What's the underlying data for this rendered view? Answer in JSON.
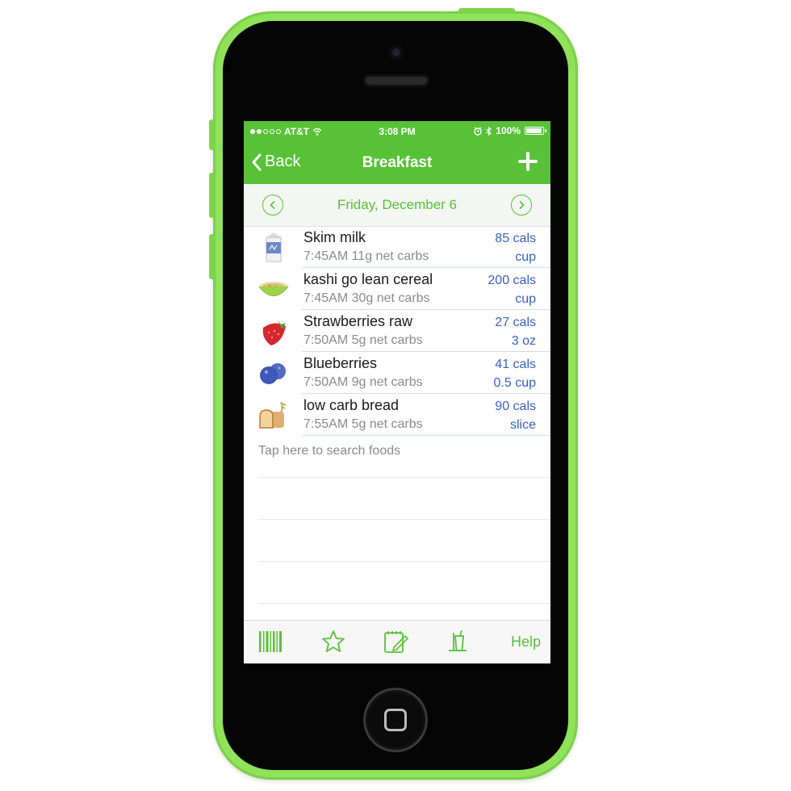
{
  "status_bar": {
    "carrier": "AT&T",
    "time": "3:08 PM",
    "battery": "100%",
    "signal_bars": 2,
    "icons": [
      "wifi-icon",
      "alarm-icon",
      "bluetooth-icon",
      "battery-icon"
    ]
  },
  "nav": {
    "back_label": "Back",
    "title": "Breakfast",
    "add_icon": "plus-icon"
  },
  "date_bar": {
    "date": "Friday, December 6",
    "prev_icon": "chevron-left-icon",
    "next_icon": "chevron-right-icon"
  },
  "foods": [
    {
      "name": "Skim milk",
      "detail": "7:45AM 11g net carbs",
      "calories": "85 cals",
      "unit": "cup",
      "icon": "milk-carton-icon"
    },
    {
      "name": "kashi go lean cereal",
      "detail": "7:45AM 30g net carbs",
      "calories": "200 cals",
      "unit": "cup",
      "icon": "cereal-bowl-icon"
    },
    {
      "name": "Strawberries raw",
      "detail": "7:50AM 5g net carbs",
      "calories": "27 cals",
      "unit": "3 oz",
      "icon": "strawberry-icon"
    },
    {
      "name": "Blueberries",
      "detail": "7:50AM 9g net carbs",
      "calories": "41 cals",
      "unit": "0.5 cup",
      "icon": "blueberries-icon"
    },
    {
      "name": "low carb bread",
      "detail": "7:55AM 5g net carbs",
      "calories": "90 cals",
      "unit": "slice",
      "icon": "bread-icon"
    }
  ],
  "search": {
    "label": "Tap here to search foods"
  },
  "tab_bar": {
    "items": [
      "barcode-icon",
      "star-icon",
      "notepad-icon",
      "drink-icon"
    ],
    "help_label": "Help"
  },
  "colors": {
    "phone_shell": "#8fe25a",
    "brand_green": "#58c137",
    "calorie_blue": "#3a60c2"
  }
}
